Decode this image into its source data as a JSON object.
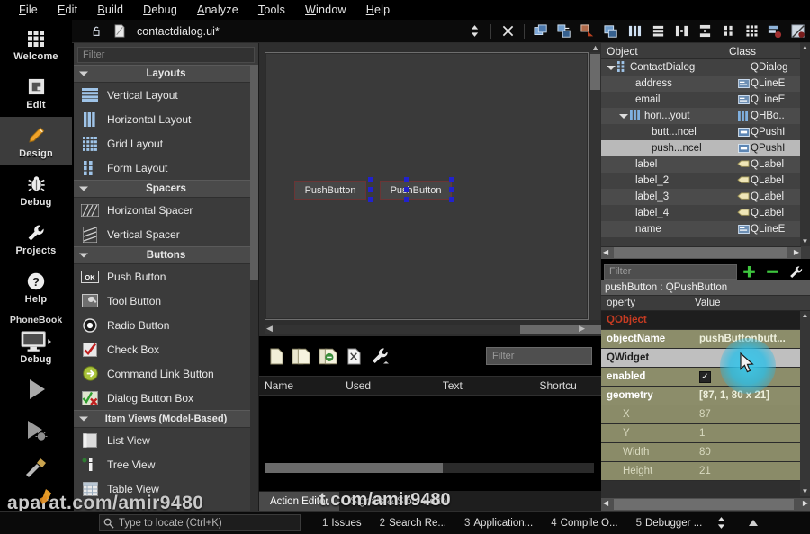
{
  "menubar": {
    "items": [
      {
        "label": "File",
        "accel": "F"
      },
      {
        "label": "Edit",
        "accel": "E"
      },
      {
        "label": "Build",
        "accel": "B"
      },
      {
        "label": "Debug",
        "accel": "D"
      },
      {
        "label": "Analyze",
        "accel": "A"
      },
      {
        "label": "Tools",
        "accel": "T"
      },
      {
        "label": "Window",
        "accel": "W"
      },
      {
        "label": "Help",
        "accel": "H"
      }
    ]
  },
  "editor_toolbar": {
    "lock_icon": "unlocked-padlock-icon",
    "file_icon": "ui-file-icon",
    "file_name": "contactdialog.ui*",
    "split_icon": "updown-arrows-icon",
    "close_icon": "close-x-icon",
    "designer_tools": [
      "edit-widgets-icon",
      "edit-signals-slots-icon",
      "edit-buddies-icon",
      "edit-tab-order-icon",
      "layout-horizontally-icon",
      "layout-vertically-icon",
      "layout-splitter-h-icon",
      "layout-splitter-v-icon",
      "layout-form-icon",
      "layout-grid-icon",
      "adjust-size-icon",
      "break-layout-icon"
    ]
  },
  "modebar": {
    "modes": [
      {
        "label": "Welcome",
        "icon": "grid-dots-icon",
        "selected": false
      },
      {
        "label": "Edit",
        "icon": "document-icon",
        "selected": false
      },
      {
        "label": "Design",
        "icon": "pencil-icon",
        "selected": true
      },
      {
        "label": "Debug",
        "icon": "bug-icon",
        "selected": false
      },
      {
        "label": "Projects",
        "icon": "wrench-icon",
        "selected": false
      },
      {
        "label": "Help",
        "icon": "question-circle-icon",
        "selected": false
      }
    ],
    "kit_name": "PhoneBook",
    "target_label": "Debug",
    "target_icon": "monitor-icon",
    "run_icon": "run-play-icon",
    "debug_icon": "start-debugging-icon",
    "build_icon": "build-hammer-icon"
  },
  "widgetbox": {
    "filter_placeholder": "Filter",
    "groups": [
      {
        "title": "Layouts",
        "items": [
          {
            "label": "Vertical Layout",
            "icon": "vertical-layout-icon"
          },
          {
            "label": "Horizontal Layout",
            "icon": "horizontal-layout-icon"
          },
          {
            "label": "Grid Layout",
            "icon": "grid-layout-icon"
          },
          {
            "label": "Form Layout",
            "icon": "form-layout-icon"
          }
        ]
      },
      {
        "title": "Spacers",
        "items": [
          {
            "label": "Horizontal Spacer",
            "icon": "horizontal-spacer-icon"
          },
          {
            "label": "Vertical Spacer",
            "icon": "vertical-spacer-icon"
          }
        ]
      },
      {
        "title": "Buttons",
        "items": [
          {
            "label": "Push Button",
            "icon": "push-button-icon"
          },
          {
            "label": "Tool Button",
            "icon": "tool-button-icon"
          },
          {
            "label": "Radio Button",
            "icon": "radio-button-icon"
          },
          {
            "label": "Check Box",
            "icon": "check-box-icon"
          },
          {
            "label": "Command Link Button",
            "icon": "command-link-button-icon"
          },
          {
            "label": "Dialog Button Box",
            "icon": "dialog-button-box-icon"
          }
        ]
      },
      {
        "title": "Item Views (Model-Based)",
        "items": [
          {
            "label": "List View",
            "icon": "list-view-icon"
          },
          {
            "label": "Tree View",
            "icon": "tree-view-icon"
          },
          {
            "label": "Table View",
            "icon": "table-view-icon"
          }
        ]
      }
    ]
  },
  "form": {
    "buttons": [
      {
        "text": "PushButton"
      },
      {
        "text": "PushButton"
      }
    ]
  },
  "action_editor": {
    "toolbar_icons": [
      "new-action-icon",
      "copy-action-icon",
      "edit-action-icon",
      "delete-action-icon",
      "configure-wrench-icon"
    ],
    "filter_placeholder": "Filter",
    "columns": [
      "Name",
      "Used",
      "Text",
      "Shortcu"
    ],
    "rows": [],
    "tabs": [
      {
        "label": "Action Editor",
        "selected": true
      },
      {
        "label": "Signals & Slots Editor",
        "selected": false
      }
    ]
  },
  "object_tree": {
    "columns": [
      "Object",
      "Class"
    ],
    "rows": [
      {
        "name": "ContactDialog",
        "class": "QDialog",
        "indent": 1,
        "twisty": true,
        "icon": "form-layout-icon",
        "selected": false
      },
      {
        "name": "address",
        "class": "QLineE",
        "indent": 3,
        "twisty": false,
        "icon": "lineedit-icon",
        "selected": false
      },
      {
        "name": "email",
        "class": "QLineE",
        "indent": 3,
        "twisty": false,
        "icon": "lineedit-icon",
        "selected": false
      },
      {
        "name": "hori...yout",
        "class": "QHBo..",
        "indent": 2,
        "twisty": true,
        "icon": "horizontal-layout-icon",
        "selected": false
      },
      {
        "name": "butt...ncel",
        "class": "QPushI",
        "indent": 4,
        "twisty": false,
        "icon": "push-button-icon",
        "selected": false
      },
      {
        "name": "push...ncel",
        "class": "QPushI",
        "indent": 4,
        "twisty": false,
        "icon": "push-button-icon",
        "selected": true
      },
      {
        "name": "label",
        "class": "QLabel",
        "indent": 3,
        "twisty": false,
        "icon": "label-icon",
        "selected": false
      },
      {
        "name": "label_2",
        "class": "QLabel",
        "indent": 3,
        "twisty": false,
        "icon": "label-icon",
        "selected": false
      },
      {
        "name": "label_3",
        "class": "QLabel",
        "indent": 3,
        "twisty": false,
        "icon": "label-icon",
        "selected": false
      },
      {
        "name": "label_4",
        "class": "QLabel",
        "indent": 3,
        "twisty": false,
        "icon": "label-icon",
        "selected": false
      },
      {
        "name": "name",
        "class": "QLineE",
        "indent": 3,
        "twisty": false,
        "icon": "lineedit-icon",
        "selected": false
      }
    ]
  },
  "property_editor": {
    "filter_placeholder": "Filter",
    "add_icon": "plus-green-icon",
    "remove_icon": "minus-green-icon",
    "configure_icon": "wrench-icon",
    "object_header": "pushButton : QPushButton",
    "columns": [
      "operty",
      "Value"
    ],
    "rows": [
      {
        "key": "QObject",
        "value": "",
        "kind": "group-dark"
      },
      {
        "key": "objectName",
        "value": "pushButtonbutt...",
        "kind": "olive-key"
      },
      {
        "key": "QWidget",
        "value": "",
        "kind": "group-light"
      },
      {
        "key": "enabled",
        "value": "",
        "kind": "olive-check",
        "checked": true
      },
      {
        "key": "geometry",
        "value": "[87, 1, 80 x 21]",
        "kind": "olive-key"
      },
      {
        "key": "X",
        "value": "87",
        "kind": "olive-sub"
      },
      {
        "key": "Y",
        "value": "1",
        "kind": "olive-sub"
      },
      {
        "key": "Width",
        "value": "80",
        "kind": "olive-sub"
      },
      {
        "key": "Height",
        "value": "21",
        "kind": "olive-sub"
      }
    ]
  },
  "bottombar": {
    "locator_icon": "magnifier-icon",
    "locator_placeholder": "Type to locate (Ctrl+K)",
    "output_tabs": [
      {
        "num": "1",
        "label": "Issues"
      },
      {
        "num": "2",
        "label": "Search Re..."
      },
      {
        "num": "3",
        "label": "Application..."
      },
      {
        "num": "4",
        "label": "Compile O..."
      },
      {
        "num": "5",
        "label": "Debugger ..."
      }
    ]
  },
  "watermark": {
    "line1": "aparat.com/amir9480",
    "line2": "t.com/amir9480"
  },
  "colors": {
    "accent_selected": "#3c3c3c",
    "property_olive": "#8c8d6a",
    "group_red": "#c63b22",
    "handle_blue": "#2222cc",
    "plus_green": "#3ec63e",
    "cursor_glow": "#3cc8eb"
  }
}
